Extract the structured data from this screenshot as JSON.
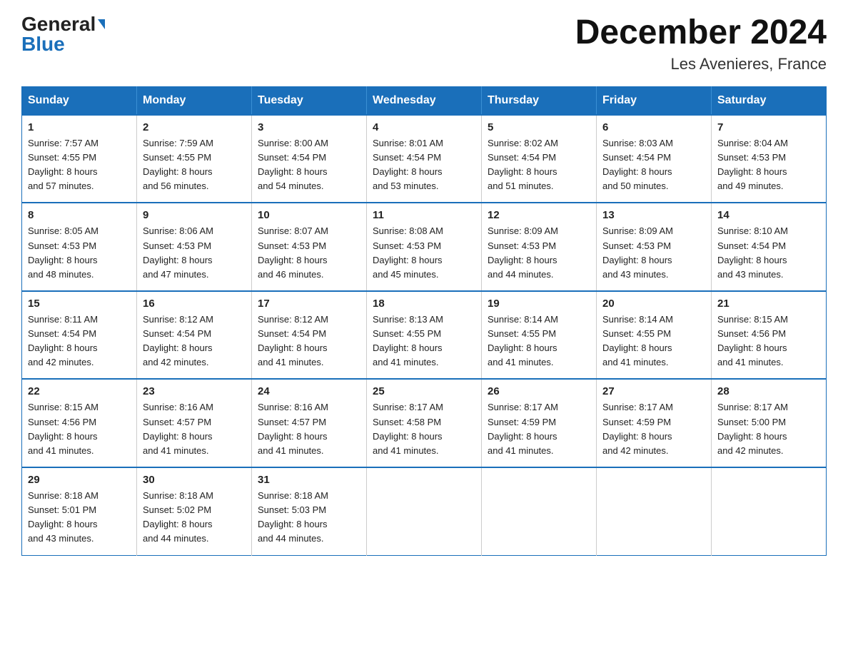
{
  "header": {
    "logo_general": "General",
    "logo_blue": "Blue",
    "title": "December 2024",
    "subtitle": "Les Avenieres, France"
  },
  "days_of_week": [
    "Sunday",
    "Monday",
    "Tuesday",
    "Wednesday",
    "Thursday",
    "Friday",
    "Saturday"
  ],
  "weeks": [
    [
      {
        "day": "1",
        "sunrise": "7:57 AM",
        "sunset": "4:55 PM",
        "daylight": "8 hours and 57 minutes."
      },
      {
        "day": "2",
        "sunrise": "7:59 AM",
        "sunset": "4:55 PM",
        "daylight": "8 hours and 56 minutes."
      },
      {
        "day": "3",
        "sunrise": "8:00 AM",
        "sunset": "4:54 PM",
        "daylight": "8 hours and 54 minutes."
      },
      {
        "day": "4",
        "sunrise": "8:01 AM",
        "sunset": "4:54 PM",
        "daylight": "8 hours and 53 minutes."
      },
      {
        "day": "5",
        "sunrise": "8:02 AM",
        "sunset": "4:54 PM",
        "daylight": "8 hours and 51 minutes."
      },
      {
        "day": "6",
        "sunrise": "8:03 AM",
        "sunset": "4:54 PM",
        "daylight": "8 hours and 50 minutes."
      },
      {
        "day": "7",
        "sunrise": "8:04 AM",
        "sunset": "4:53 PM",
        "daylight": "8 hours and 49 minutes."
      }
    ],
    [
      {
        "day": "8",
        "sunrise": "8:05 AM",
        "sunset": "4:53 PM",
        "daylight": "8 hours and 48 minutes."
      },
      {
        "day": "9",
        "sunrise": "8:06 AM",
        "sunset": "4:53 PM",
        "daylight": "8 hours and 47 minutes."
      },
      {
        "day": "10",
        "sunrise": "8:07 AM",
        "sunset": "4:53 PM",
        "daylight": "8 hours and 46 minutes."
      },
      {
        "day": "11",
        "sunrise": "8:08 AM",
        "sunset": "4:53 PM",
        "daylight": "8 hours and 45 minutes."
      },
      {
        "day": "12",
        "sunrise": "8:09 AM",
        "sunset": "4:53 PM",
        "daylight": "8 hours and 44 minutes."
      },
      {
        "day": "13",
        "sunrise": "8:09 AM",
        "sunset": "4:53 PM",
        "daylight": "8 hours and 43 minutes."
      },
      {
        "day": "14",
        "sunrise": "8:10 AM",
        "sunset": "4:54 PM",
        "daylight": "8 hours and 43 minutes."
      }
    ],
    [
      {
        "day": "15",
        "sunrise": "8:11 AM",
        "sunset": "4:54 PM",
        "daylight": "8 hours and 42 minutes."
      },
      {
        "day": "16",
        "sunrise": "8:12 AM",
        "sunset": "4:54 PM",
        "daylight": "8 hours and 42 minutes."
      },
      {
        "day": "17",
        "sunrise": "8:12 AM",
        "sunset": "4:54 PM",
        "daylight": "8 hours and 41 minutes."
      },
      {
        "day": "18",
        "sunrise": "8:13 AM",
        "sunset": "4:55 PM",
        "daylight": "8 hours and 41 minutes."
      },
      {
        "day": "19",
        "sunrise": "8:14 AM",
        "sunset": "4:55 PM",
        "daylight": "8 hours and 41 minutes."
      },
      {
        "day": "20",
        "sunrise": "8:14 AM",
        "sunset": "4:55 PM",
        "daylight": "8 hours and 41 minutes."
      },
      {
        "day": "21",
        "sunrise": "8:15 AM",
        "sunset": "4:56 PM",
        "daylight": "8 hours and 41 minutes."
      }
    ],
    [
      {
        "day": "22",
        "sunrise": "8:15 AM",
        "sunset": "4:56 PM",
        "daylight": "8 hours and 41 minutes."
      },
      {
        "day": "23",
        "sunrise": "8:16 AM",
        "sunset": "4:57 PM",
        "daylight": "8 hours and 41 minutes."
      },
      {
        "day": "24",
        "sunrise": "8:16 AM",
        "sunset": "4:57 PM",
        "daylight": "8 hours and 41 minutes."
      },
      {
        "day": "25",
        "sunrise": "8:17 AM",
        "sunset": "4:58 PM",
        "daylight": "8 hours and 41 minutes."
      },
      {
        "day": "26",
        "sunrise": "8:17 AM",
        "sunset": "4:59 PM",
        "daylight": "8 hours and 41 minutes."
      },
      {
        "day": "27",
        "sunrise": "8:17 AM",
        "sunset": "4:59 PM",
        "daylight": "8 hours and 42 minutes."
      },
      {
        "day": "28",
        "sunrise": "8:17 AM",
        "sunset": "5:00 PM",
        "daylight": "8 hours and 42 minutes."
      }
    ],
    [
      {
        "day": "29",
        "sunrise": "8:18 AM",
        "sunset": "5:01 PM",
        "daylight": "8 hours and 43 minutes."
      },
      {
        "day": "30",
        "sunrise": "8:18 AM",
        "sunset": "5:02 PM",
        "daylight": "8 hours and 44 minutes."
      },
      {
        "day": "31",
        "sunrise": "8:18 AM",
        "sunset": "5:03 PM",
        "daylight": "8 hours and 44 minutes."
      },
      null,
      null,
      null,
      null
    ]
  ],
  "labels": {
    "sunrise": "Sunrise:",
    "sunset": "Sunset:",
    "daylight": "Daylight:"
  }
}
